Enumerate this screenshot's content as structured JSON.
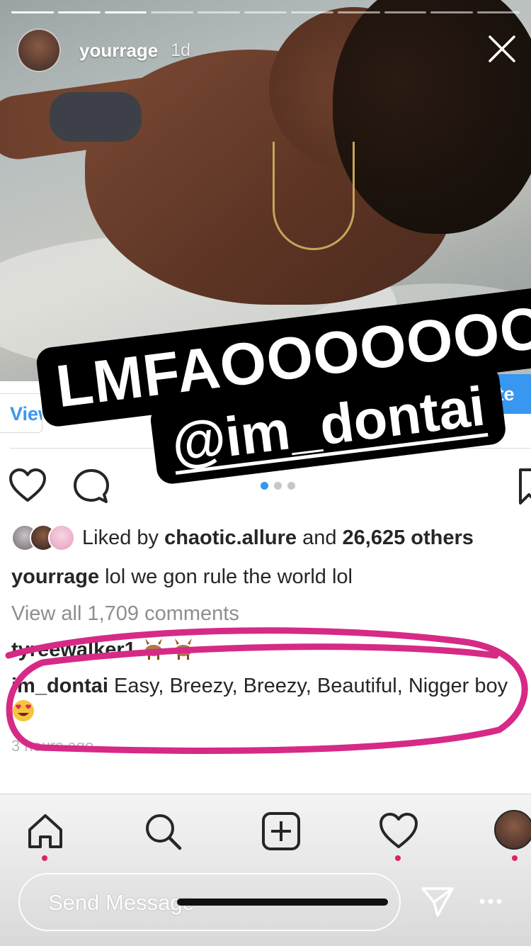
{
  "story": {
    "username": "yourrage",
    "time_ago": "1d",
    "progress_segments": 11,
    "progress_done": 3
  },
  "sticker": {
    "line1": "LMFAOOOOOOO",
    "line2": "@im_dontai"
  },
  "post": {
    "view_left_label": "View",
    "view_right_label": "ote",
    "carousel_dots": 3,
    "carousel_active": 0,
    "liked_prefix": "Liked by ",
    "liked_user": "chaotic.allure",
    "liked_mid": " and ",
    "liked_count": "26,625 others",
    "caption_user": "yourrage",
    "caption_text": " lol we gon rule the world lol",
    "view_comments": "View all 1,709 comments",
    "comments": [
      {
        "user": "tyreewalker1",
        "text": ""
      },
      {
        "user": "im_dontai",
        "text": " Easy, Breezy, Breezy, Beautiful, Nigger boy "
      }
    ],
    "comment_time": "3 hours ago"
  },
  "colors": {
    "accent": "#3897f0",
    "highlight": "#d62a86",
    "notification": "#e0245e"
  },
  "icons": [
    "heart-icon",
    "comment-icon",
    "bookmark-icon",
    "close-icon",
    "home-icon",
    "search-icon",
    "add-icon",
    "activity-heart-icon",
    "send-icon",
    "more-icon"
  ],
  "reply": {
    "placeholder": "Send Message"
  }
}
